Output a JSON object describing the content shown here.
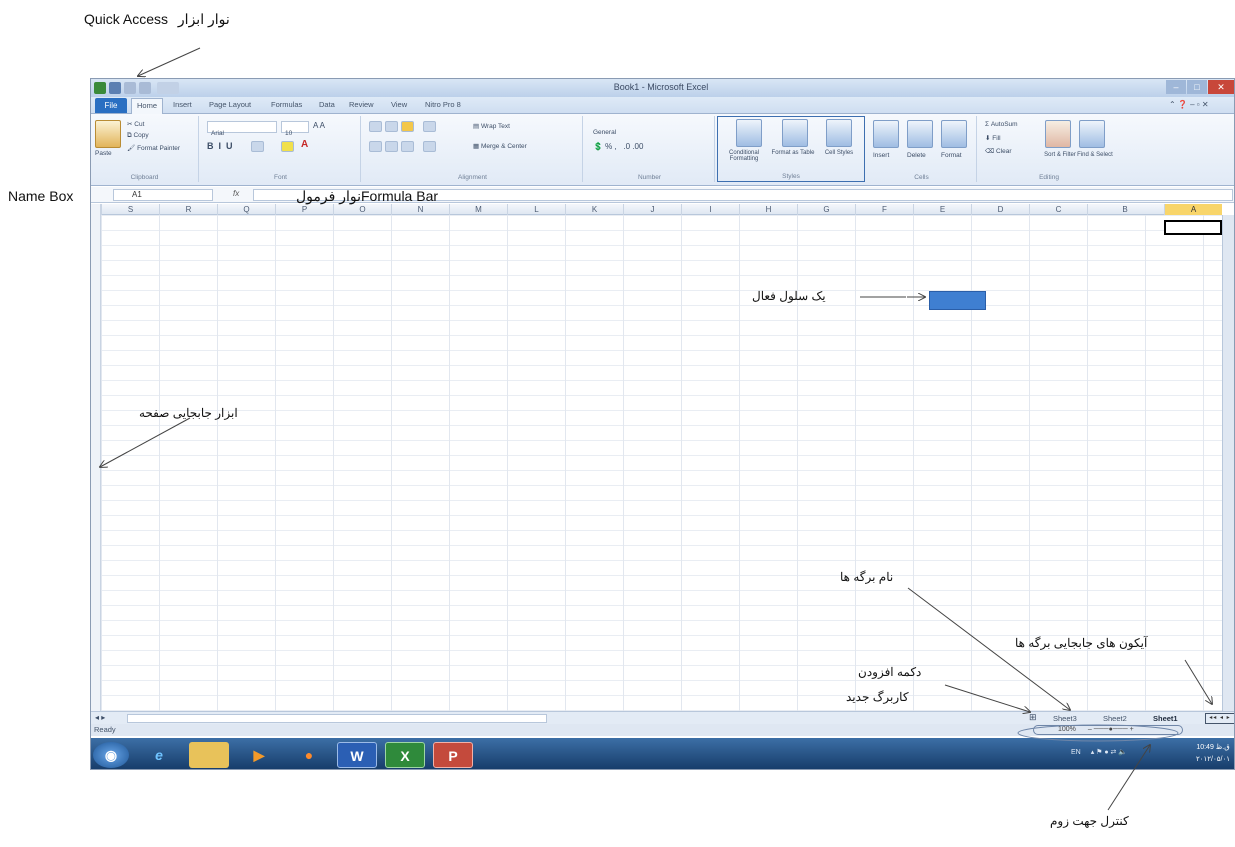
{
  "excel": {
    "window_title": "Book1 - Microsoft Excel",
    "tabs": [
      "File",
      "Home",
      "Insert",
      "Page Layout",
      "Formulas",
      "Data",
      "Review",
      "View",
      "Nitro Pro 8"
    ],
    "ribbon": {
      "clipboard": {
        "paste": "Paste",
        "cut": "Cut",
        "copy": "Copy",
        "format_painter": "Format Painter",
        "label": "Clipboard"
      },
      "font": {
        "name": "Arial",
        "size": "10",
        "label": "Font"
      },
      "alignment": {
        "wrap_text": "Wrap Text",
        "merge_center": "Merge & Center",
        "label": "Alignment"
      },
      "number": {
        "format": "General",
        "label": "Number"
      },
      "styles": {
        "conditional": "Conditional Formatting",
        "format_table": "Format as Table",
        "cell_styles": "Cell Styles",
        "label": "Styles"
      },
      "cells": {
        "insert": "Insert",
        "delete": "Delete",
        "format": "Format",
        "label": "Cells"
      },
      "editing": {
        "autosum": "AutoSum",
        "fill": "Fill",
        "clear": "Clear",
        "sort_filter": "Sort & Filter",
        "find_select": "Find & Select",
        "label": "Editing"
      }
    },
    "name_box": "A1",
    "fx": "fx",
    "columns": [
      "S",
      "R",
      "Q",
      "P",
      "O",
      "N",
      "M",
      "L",
      "K",
      "J",
      "I",
      "H",
      "G",
      "F",
      "E",
      "D",
      "C",
      "B",
      "A"
    ],
    "sheets": [
      "Sheet3",
      "Sheet2",
      "Sheet1"
    ],
    "status": "Ready",
    "zoom": "100%",
    "taskbar": {
      "lang": "EN",
      "clock_time": "10:49 ق.ظ",
      "clock_date": "۲۰۱۲/۰۵/۰۱"
    }
  },
  "annotations": {
    "quick_access_en": "Quick Access",
    "quick_access_fa": "نوار ابزار",
    "name_box": "Name Box",
    "formula_bar_fa": "نوار فرمول",
    "formula_bar_en": "Formula Bar",
    "active_cell": "یک سلول فعال",
    "page_scroll": "ابزار جابجایی صفحه",
    "sheet_names": "نام برگه ها",
    "sheet_nav_icons": "آیکون های جابجایی برگه ها",
    "new_sheet_line1": "دکمه افزودن",
    "new_sheet_line2": "کاربرگ جدید",
    "zoom_control": "کنترل جهت زوم"
  }
}
